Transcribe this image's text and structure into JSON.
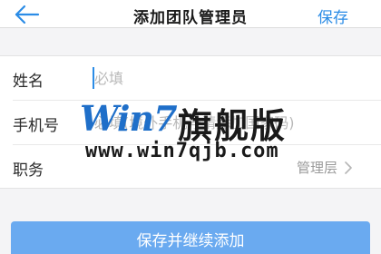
{
  "header": {
    "title": "添加团队管理员",
    "save_label": "保存"
  },
  "form": {
    "name": {
      "label": "姓名",
      "placeholder": "必填",
      "value": ""
    },
    "phone": {
      "label": "手机号",
      "placeholder": "必填(境外手机号请添加国家码)",
      "value": ""
    },
    "role": {
      "label": "职务",
      "value": "管理层"
    }
  },
  "watermark": {
    "logo": "Win7",
    "cn": "旗舰版",
    "url": "www.win7qjb.com"
  },
  "footer": {
    "button_label": "保存并继续添加"
  },
  "colors": {
    "accent": "#2b8ce6",
    "button": "#6aaaf0",
    "watermark_blue": "#1f6fc9"
  },
  "icons": [
    "back-arrow-icon",
    "chevron-right-icon"
  ]
}
